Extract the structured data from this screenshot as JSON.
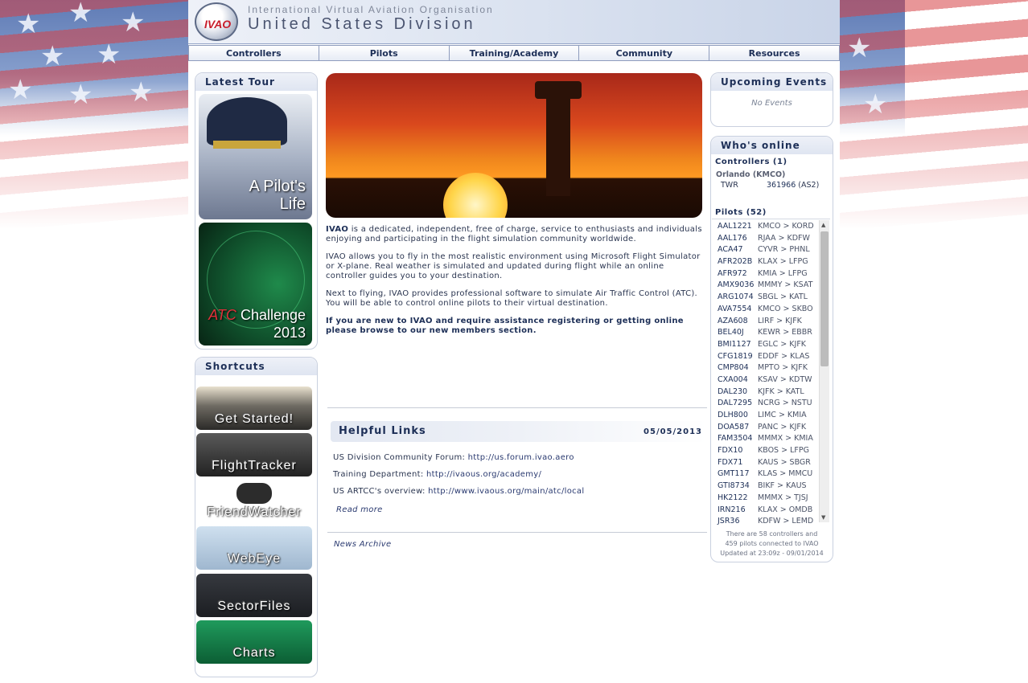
{
  "header": {
    "logo_text": "IVAO",
    "org_name": "International Virtual Aviation Organisation",
    "division": "United States Division"
  },
  "nav": [
    "Controllers",
    "Pilots",
    "Training/Academy",
    "Community",
    "Resources"
  ],
  "latest_tour": {
    "title": "Latest Tour",
    "tour1_line1": "A Pilot's",
    "tour1_line2": "Life",
    "tour2_red": "ATC",
    "tour2_rest": " Challenge",
    "tour2_year": "2013"
  },
  "shortcuts": {
    "title": "Shortcuts",
    "items": [
      "Get Started!",
      "FlightTracker",
      "FriendWatcher",
      "WebEye",
      "SectorFiles",
      "Charts"
    ]
  },
  "intro": {
    "p1_bold": "IVAO",
    "p1_rest": " is a dedicated, independent, free of charge, service to enthusiasts and individuals enjoying and participating in the flight simulation community worldwide.",
    "p2": "IVAO allows you to fly in the most realistic environment using Microsoft Flight Simulator or X-plane. Real weather is simulated and updated during flight while an online controller guides you to your destination.",
    "p3": "Next to flying, IVAO provides professional software to simulate Air Traffic Control (ATC). You will be able to control online pilots to their virtual destination.",
    "p4": "If you are new to IVAO and require assistance registering or getting online please browse to our new members section."
  },
  "helpful_links": {
    "title": "Helpful Links",
    "date": "05/05/2013",
    "links": [
      {
        "label": "US Division Community Forum: ",
        "url": "http://us.forum.ivao.aero"
      },
      {
        "label": "Training Department: ",
        "url": "http://ivaous.org/academy/"
      },
      {
        "label": "US ARTCC's overview: ",
        "url": "http://www.ivaous.org/main/atc/local"
      }
    ],
    "read_more": "Read more",
    "news_archive": "News Archive"
  },
  "events": {
    "title": "Upcoming Events",
    "empty": "No Events"
  },
  "whos_online": {
    "title": "Who's online",
    "controllers_header": "Controllers (1)",
    "station": "Orlando (KMCO)",
    "ctrl_pos": "TWR",
    "ctrl_id": "361966",
    "ctrl_rating": " (AS2)",
    "pilots_header": "Pilots (52)",
    "pilots": [
      {
        "cs": "AAL1221",
        "route": "KMCO > KORD"
      },
      {
        "cs": "AAL176",
        "route": "RJAA  > KDFW"
      },
      {
        "cs": "ACA47",
        "route": "CYVR  > PHNL"
      },
      {
        "cs": "AFR202B",
        "route": "KLAX  > LFPG"
      },
      {
        "cs": "AFR972",
        "route": "KMIA  > LFPG"
      },
      {
        "cs": "AMX9036",
        "route": "MMMY > KSAT"
      },
      {
        "cs": "ARG1074",
        "route": "SBGL  > KATL"
      },
      {
        "cs": "AVA7554",
        "route": "KMCO > SKBO"
      },
      {
        "cs": "AZA608",
        "route": "LIRF  > KJFK"
      },
      {
        "cs": "BEL40J",
        "route": "KEWR > EBBR"
      },
      {
        "cs": "BMI1127",
        "route": "EGLC  > KJFK"
      },
      {
        "cs": "CFG1819",
        "route": "EDDF  > KLAS"
      },
      {
        "cs": "CMP804",
        "route": "MPTO  > KJFK"
      },
      {
        "cs": "CXA004",
        "route": "KSAV  > KDTW"
      },
      {
        "cs": "DAL230",
        "route": "KJFK  > KATL"
      },
      {
        "cs": "DAL7295",
        "route": "NCRG > NSTU"
      },
      {
        "cs": "DLH800",
        "route": "LIMC  > KMIA"
      },
      {
        "cs": "DOA587",
        "route": "PANC  > KJFK"
      },
      {
        "cs": "FAM3504",
        "route": "MMMX > KMIA"
      },
      {
        "cs": "FDX10",
        "route": "KBOS  > LFPG"
      },
      {
        "cs": "FDX71",
        "route": "KAUS  > SBGR"
      },
      {
        "cs": "GMT117",
        "route": "KLAS  > MMCU"
      },
      {
        "cs": "GTI8734",
        "route": "BIKF  > KAUS"
      },
      {
        "cs": "HK2122",
        "route": "MMMX > TJSJ"
      },
      {
        "cs": "IRN216",
        "route": "KLAX  > OMDB"
      },
      {
        "cs": "JSR36",
        "route": "KDFW > LEMD"
      }
    ],
    "note_line1": "There are 58 controllers and",
    "note_line2": "459 pilots connected to IVAO",
    "note_line3": "Updated at 23:09z - 09/01/2014"
  },
  "colors": {
    "accent_navy": "#1d2f57",
    "flag_red": "#d64044",
    "flag_blue": "#5f7bb5"
  }
}
